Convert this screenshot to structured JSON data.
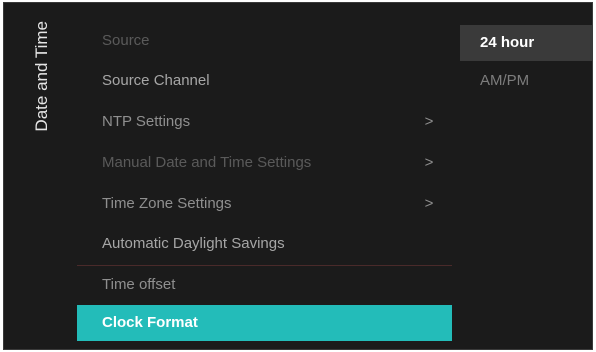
{
  "panel": {
    "title": "Date and Time"
  },
  "menu": {
    "items": [
      {
        "label": "Source",
        "chevron": ""
      },
      {
        "label": "Source Channel",
        "chevron": ""
      },
      {
        "label": "NTP Settings",
        "chevron": ">"
      },
      {
        "label": "Manual Date and Time Settings",
        "chevron": ">"
      },
      {
        "label": "Time Zone Settings",
        "chevron": ">"
      },
      {
        "label": "Automatic Daylight Savings",
        "chevron": ""
      },
      {
        "label": "Time offset",
        "chevron": ""
      },
      {
        "label": "Clock Format",
        "chevron": ""
      }
    ],
    "selected_index": 7
  },
  "submenu": {
    "options": [
      {
        "label": "24 hour"
      },
      {
        "label": "AM/PM"
      }
    ],
    "selected_index": 0
  },
  "colors": {
    "accent": "#23bcb9",
    "background": "#1b1b1b",
    "submenu_highlight": "#3a3a3a"
  }
}
